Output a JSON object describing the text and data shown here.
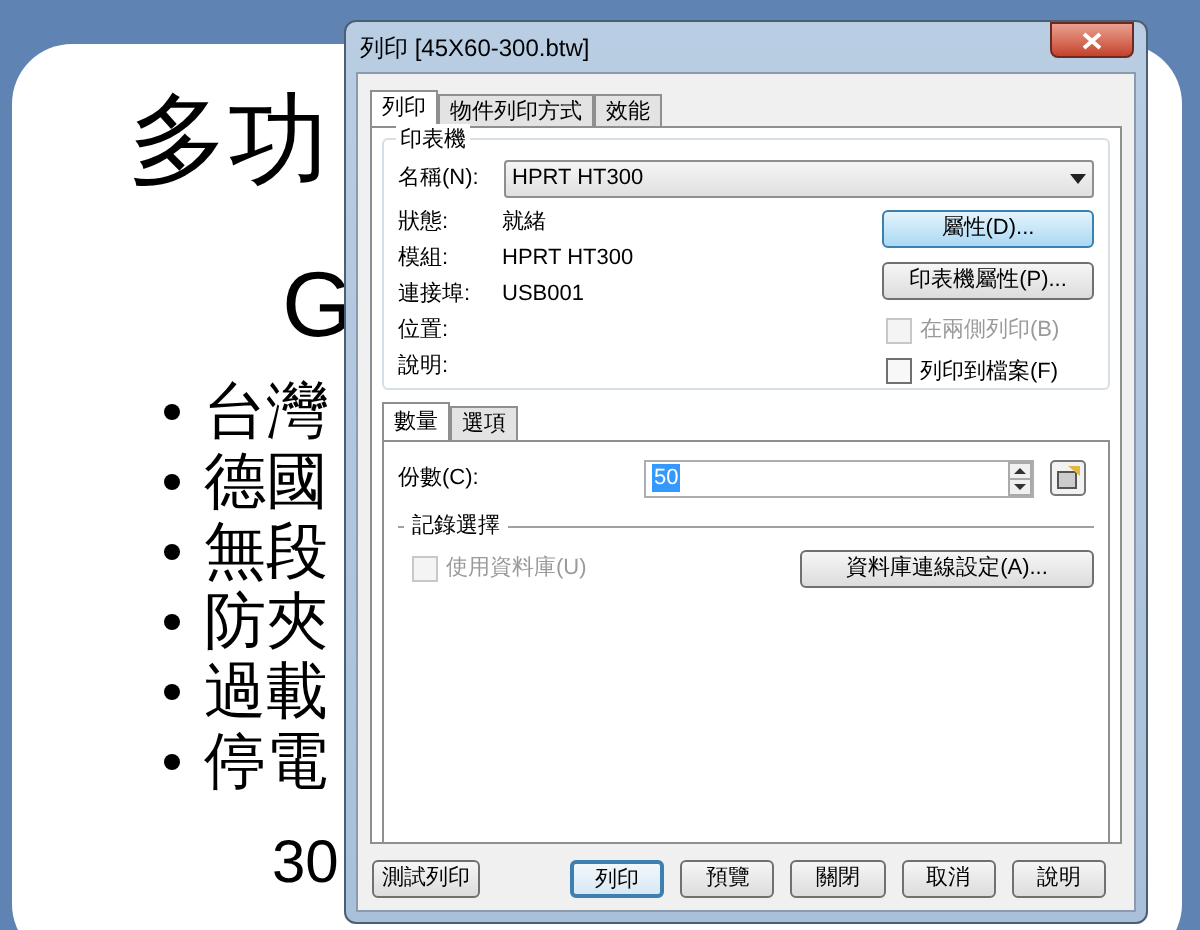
{
  "slide": {
    "title": "多功",
    "subtitle": "G",
    "bullets": [
      "台灣",
      "德國",
      "無段",
      "防夾",
      "過載",
      "停電"
    ],
    "footer": "30"
  },
  "dialog": {
    "title": "列印 [45X60-300.btw]",
    "tabs": [
      {
        "label": "列印",
        "selected": true
      },
      {
        "label": "物件列印方式",
        "selected": false
      },
      {
        "label": "效能",
        "selected": false
      }
    ],
    "printer": {
      "legend": "印表機",
      "name_label": "名稱(N):",
      "name_value": "HPRT HT300",
      "info": [
        {
          "label": "狀態:",
          "value": "就緒"
        },
        {
          "label": "模組:",
          "value": "HPRT HT300"
        },
        {
          "label": "連接埠:",
          "value": "USB001"
        },
        {
          "label": "位置:"
        },
        {
          "label": "說明:"
        }
      ],
      "buttons": [
        {
          "label": "屬性(D)...",
          "focused": true
        },
        {
          "label": "印表機屬性(P)...",
          "focused": false
        }
      ],
      "options": [
        {
          "label": "在兩側列印(B)",
          "checked": false,
          "disabled": true
        },
        {
          "label": "列印到檔案(F)",
          "checked": false,
          "disabled": false
        }
      ]
    },
    "sub_tabs": [
      {
        "label": "數量",
        "selected": true
      },
      {
        "label": "選項",
        "selected": false
      }
    ],
    "copies": {
      "label": "份數(C):",
      "value": "50",
      "selected": true
    },
    "records": {
      "legend": "記錄選擇",
      "use_database": {
        "label": "使用資料庫(U)",
        "checked": false,
        "disabled": true
      },
      "button": "資料庫連線設定(A)..."
    },
    "footer_buttons": [
      {
        "label": "測試列印",
        "default": false
      },
      {
        "label": "列印",
        "default": true
      },
      {
        "label": "預覽",
        "default": false
      },
      {
        "label": "關閉",
        "default": false
      },
      {
        "label": "取消",
        "default": false
      },
      {
        "label": "說明",
        "default": false
      }
    ]
  }
}
